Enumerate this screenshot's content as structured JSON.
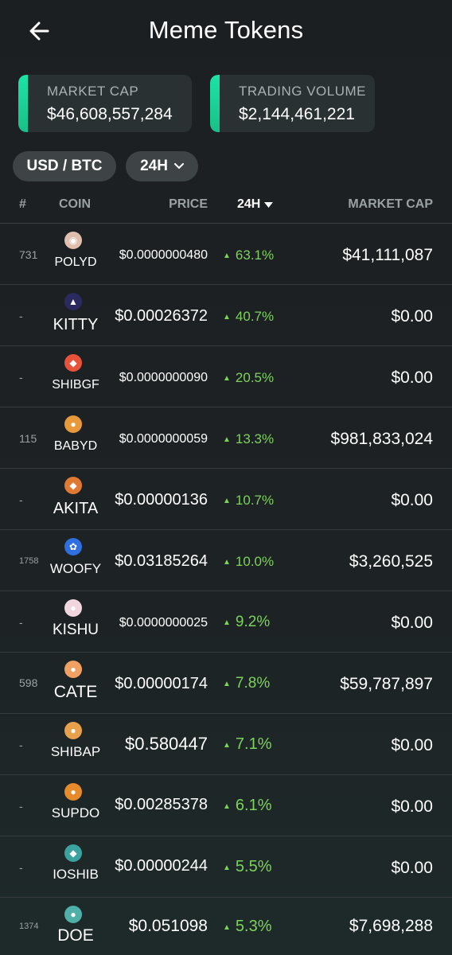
{
  "header": {
    "title": "Meme Tokens",
    "back_icon": "arrow-left-icon"
  },
  "stats": {
    "market_cap": {
      "label": "MARKET CAP",
      "value": "$46,608,557,284"
    },
    "trading_volume": {
      "label": "TRADING VOLUME",
      "value": "$2,144,461,221"
    }
  },
  "filters": {
    "currency": "USD / BTC",
    "period": "24H"
  },
  "columns": {
    "rank": "#",
    "coin": "COIN",
    "price": "PRICE",
    "change": "24H",
    "market_cap": "MARKET CAP"
  },
  "colors": {
    "accent": "#1de3a6",
    "positive": "#7cd35a",
    "card": "#2a3133"
  },
  "rows": [
    {
      "rank": "731",
      "symbol": "POLYD",
      "price": "$0.0000000480",
      "change": "63.1%",
      "market_cap": "$41,111,087",
      "icon": "poly-doge-icon"
    },
    {
      "rank": "-",
      "symbol": "KITTY",
      "price": "$0.00026372",
      "change": "40.7%",
      "market_cap": "$0.00",
      "icon": "kitty-icon"
    },
    {
      "rank": "-",
      "symbol": "SHIBGF",
      "price": "$0.0000000090",
      "change": "20.5%",
      "market_cap": "$0.00",
      "icon": "shibgf-icon"
    },
    {
      "rank": "115",
      "symbol": "BABYD",
      "price": "$0.0000000059",
      "change": "13.3%",
      "market_cap": "$981,833,024",
      "icon": "baby-doge-icon"
    },
    {
      "rank": "-",
      "symbol": "AKITA",
      "price": "$0.00000136",
      "change": "10.7%",
      "market_cap": "$0.00",
      "icon": "akita-icon"
    },
    {
      "rank": "1758",
      "symbol": "WOOFY",
      "price": "$0.03185264",
      "change": "10.0%",
      "market_cap": "$3,260,525",
      "icon": "paw-icon"
    },
    {
      "rank": "-",
      "symbol": "KISHU",
      "price": "$0.0000000025",
      "change": "9.2%",
      "market_cap": "$0.00",
      "icon": "kishu-icon"
    },
    {
      "rank": "598",
      "symbol": "CATE",
      "price": "$0.00000174",
      "change": "7.8%",
      "market_cap": "$59,787,897",
      "icon": "cate-icon"
    },
    {
      "rank": "-",
      "symbol": "SHIBAP",
      "price": "$0.580447",
      "change": "7.1%",
      "market_cap": "$0.00",
      "icon": "shibap-icon"
    },
    {
      "rank": "-",
      "symbol": "SUPDO",
      "price": "$0.00285378",
      "change": "6.1%",
      "market_cap": "$0.00",
      "icon": "supdo-icon"
    },
    {
      "rank": "-",
      "symbol": "IOSHIB",
      "price": "$0.00000244",
      "change": "5.5%",
      "market_cap": "$0.00",
      "icon": "ioshib-icon"
    },
    {
      "rank": "1374",
      "symbol": "DOE",
      "price": "$0.051098",
      "change": "5.3%",
      "market_cap": "$7,698,288",
      "icon": "doe-icon"
    }
  ]
}
